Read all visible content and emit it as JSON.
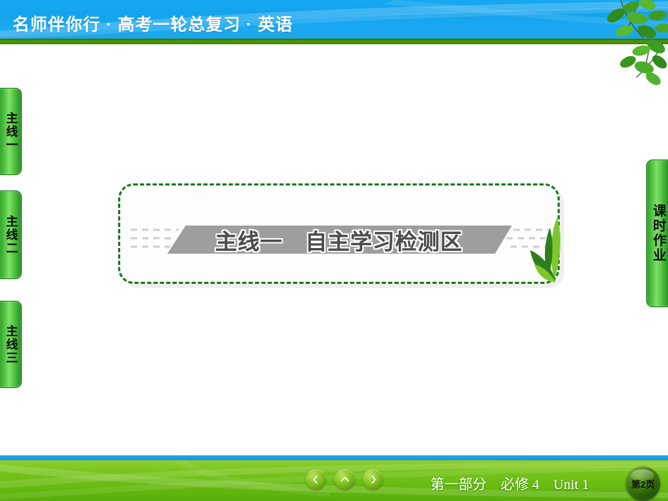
{
  "header": {
    "title": "名师伴你行  ·  高考一轮总复习  ·   英语",
    "bg_color": "#16a8f0",
    "band_color": "#4e9605"
  },
  "left_tabs": [
    {
      "label": "主线一",
      "name": "sidebar-tab-zhuxian-yi"
    },
    {
      "label": "主线二",
      "name": "sidebar-tab-zhuxian-er"
    },
    {
      "label": "主线三",
      "name": "sidebar-tab-zhuxian-san"
    }
  ],
  "right_tab": {
    "label": "课时作业",
    "name": "sidebar-tab-keshi-zuoye"
  },
  "main": {
    "banner_title": "主线一　自主学习检测区",
    "banner_color": "#9b9b9b",
    "border_color": "#1a7a18",
    "text_color": "#4d4d4d"
  },
  "footer": {
    "nav": {
      "prev_label": "上一页",
      "up_label": "返回",
      "next_label": "下一页"
    },
    "breadcrumb": "第一部分　必修 4　Unit 1",
    "page_badge": "第2页",
    "bg_color": "#66ba10",
    "strip_color": "#1fa8ef"
  },
  "decor": {
    "leaf_color_dark": "#2e7d1f",
    "leaf_color_mid": "#49a82c",
    "leaf_color_light": "#7dc832"
  }
}
